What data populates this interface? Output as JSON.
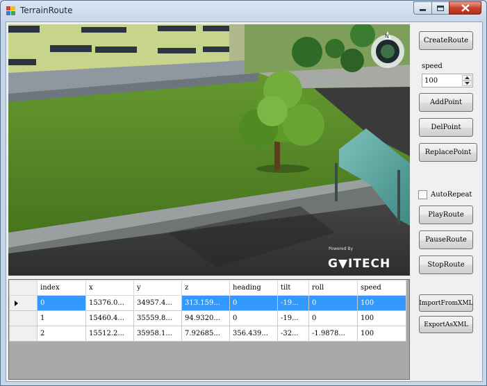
{
  "window": {
    "title": "TerrainRoute"
  },
  "scene": {
    "watermark_small": "Powered By",
    "watermark_logo": "G▼ITECH"
  },
  "controls": {
    "create_route": "CreateRoute",
    "speed_label": "speed",
    "speed_value": "100",
    "add_point": "AddPoint",
    "del_point": "DelPoint",
    "replace_point": "ReplacePoint",
    "auto_repeat": "AutoRepeat",
    "play_route": "PlayRoute",
    "pause_route": "PauseRoute",
    "stop_route": "StopRoute",
    "import_xml": "ImportFromXML",
    "export_xml": "ExportAsXML"
  },
  "grid": {
    "columns": [
      "index",
      "x",
      "y",
      "z",
      "heading",
      "tilt",
      "roll",
      "speed"
    ],
    "rows": [
      [
        "0",
        "15376.0...",
        "34957.4...",
        "313.159...",
        "0",
        "-19...",
        "0",
        "100"
      ],
      [
        "1",
        "15460.4...",
        "35559.8...",
        "94.9320...",
        "0",
        "-19...",
        "0",
        "100"
      ],
      [
        "2",
        "15512.2...",
        "35958.1...",
        "7.92685...",
        "356.439...",
        "-32...",
        "-1.9878...",
        "100"
      ]
    ],
    "selected_row": 0
  },
  "colors": {
    "selection": "#3399ff",
    "close_button": "#c7442c"
  }
}
